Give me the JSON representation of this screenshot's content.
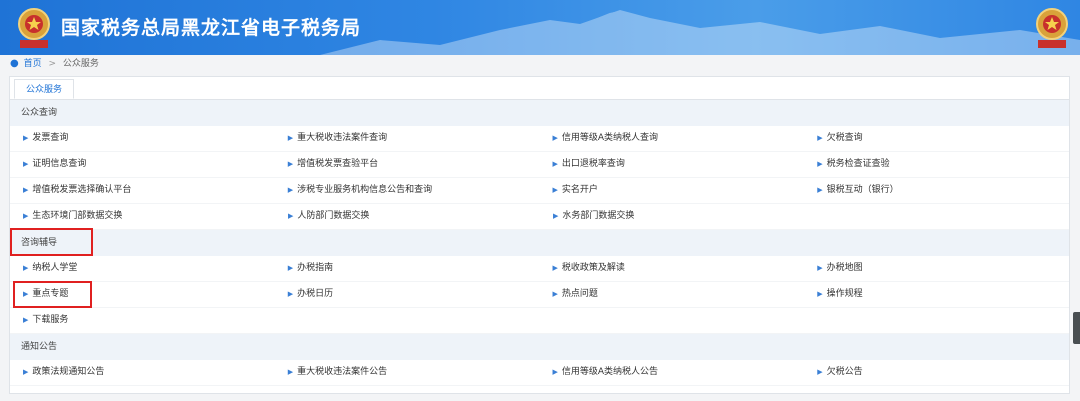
{
  "header": {
    "title": "国家税务总局黑龙江省电子税务局",
    "brand_color": "#1f73d6"
  },
  "breadcrumb": {
    "home": "首页",
    "separator": ">",
    "current": "公众服务"
  },
  "tabs": [
    {
      "label": "公众服务"
    }
  ],
  "sections": [
    {
      "title": "公众查询",
      "rows": [
        [
          "发票查询",
          "重大税收违法案件查询",
          "信用等级A类纳税人查询",
          "欠税查询"
        ],
        [
          "证明信息查询",
          "增值税发票查验平台",
          "出口退税率查询",
          "税务检查证查验"
        ],
        [
          "增值税发票选择确认平台",
          "涉税专业服务机构信息公告和查询",
          "实名开户",
          "银税互动（银行）"
        ],
        [
          "生态环境门部数据交换",
          "人防部门数据交换",
          "水务部门数据交换"
        ]
      ]
    },
    {
      "title": "咨询辅导",
      "rows": [
        [
          "纳税人学堂",
          "办税指南",
          "税收政策及解读",
          "办税地图"
        ],
        [
          "重点专题",
          "办税日历",
          "热点问题",
          "操作规程"
        ],
        [
          "下载服务"
        ]
      ]
    },
    {
      "title": "通知公告",
      "rows": [
        [
          "政策法规通知公告",
          "重大税收违法案件公告",
          "信用等级A类纳税人公告",
          "欠税公告"
        ]
      ]
    }
  ]
}
